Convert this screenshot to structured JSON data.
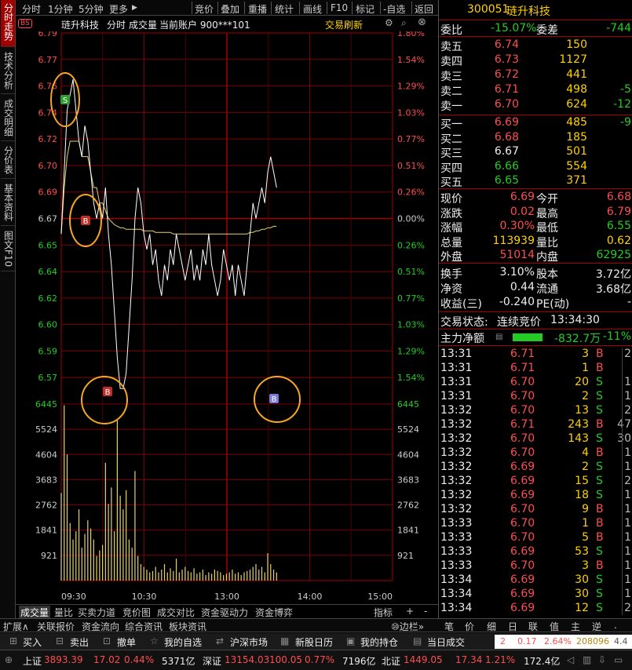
{
  "left_tabs": [
    "分时走势",
    "技术分析",
    "成交明细",
    "分价表",
    "基本资料",
    "图文F10"
  ],
  "top_menu": {
    "left": [
      "分时",
      "1分钟",
      "5分钟",
      "更多"
    ],
    "right": [
      "竞价",
      "叠加",
      "重播",
      "统计",
      "画线",
      "F10",
      "标记",
      "-自选",
      "返回"
    ]
  },
  "chart_info": {
    "name": "琏升科技",
    "mode": "分时",
    "volume_label": "成交量",
    "account": "当前账户 900***101",
    "refresh": "交易刷新",
    "bs_badge": "BS"
  },
  "price_axis": {
    "left": [
      "6.79",
      "6.77",
      "6.76",
      "6.74",
      "6.72",
      "6.70",
      "6.69",
      "6.67",
      "6.65",
      "6.64",
      "6.62",
      "6.60",
      "6.59",
      "6.57",
      "6445"
    ],
    "right": [
      "1.80%",
      "1.54%",
      "1.29%",
      "1.03%",
      "0.77%",
      "0.51%",
      "0.26%",
      "0.00%",
      "0.26%",
      "0.51%",
      "0.77%",
      "1.03%",
      "1.29%",
      "1.54%",
      "6445"
    ]
  },
  "volume_axis": [
    "5524",
    "4604",
    "3683",
    "2762",
    "1841",
    "921"
  ],
  "time_axis": [
    "09:30",
    "10:30",
    "13:00",
    "14:00",
    "15:00"
  ],
  "chart_data": {
    "type": "line",
    "prev_close": 6.67,
    "ylim": [
      6.55,
      6.79
    ],
    "price": [
      6.66,
      6.7,
      6.74,
      6.75,
      6.76,
      6.74,
      6.72,
      6.71,
      6.73,
      6.72,
      6.7,
      6.68,
      6.67,
      6.68,
      6.67,
      6.69,
      6.66,
      6.64,
      6.61,
      6.58,
      6.56,
      6.56,
      6.57,
      6.6,
      6.63,
      6.67,
      6.69,
      6.68,
      6.66,
      6.65,
      6.66,
      6.64,
      6.65,
      6.63,
      6.62,
      6.64,
      6.63,
      6.65,
      6.64,
      6.66,
      6.65,
      6.64,
      6.63,
      6.64,
      6.65,
      6.63,
      6.64,
      6.63,
      6.65,
      6.64,
      6.66,
      6.64,
      6.63,
      6.62,
      6.63,
      6.65,
      6.64,
      6.63,
      6.64,
      6.62,
      6.64,
      6.63,
      6.62,
      6.64,
      6.66,
      6.68,
      6.67,
      6.68,
      6.69,
      6.68,
      6.7,
      6.71,
      6.7,
      6.69
    ],
    "avg": [
      6.66,
      6.69,
      6.71,
      6.72,
      6.72,
      6.72,
      6.72,
      6.71,
      6.71,
      6.71,
      6.7,
      6.69,
      6.69,
      6.68,
      6.68,
      6.675,
      6.67,
      6.668,
      6.666,
      6.665,
      6.664,
      6.664,
      6.663,
      6.663,
      6.663,
      6.663,
      6.663,
      6.663,
      6.662,
      6.662,
      6.662,
      6.662,
      6.661,
      6.661,
      6.661,
      6.661,
      6.661,
      6.661,
      6.66,
      6.66,
      6.66,
      6.66,
      6.66,
      6.66,
      6.66,
      6.66,
      6.66,
      6.66,
      6.66,
      6.66,
      6.66,
      6.66,
      6.66,
      6.66,
      6.66,
      6.66,
      6.66,
      6.66,
      6.66,
      6.66,
      6.66,
      6.66,
      6.66,
      6.66,
      6.661,
      6.661,
      6.662,
      6.662,
      6.663,
      6.663,
      6.664,
      6.664,
      6.665,
      6.665
    ],
    "volume": [
      3200,
      6400,
      4600,
      2100,
      1500,
      1800,
      2600,
      1200,
      1700,
      2200,
      1900,
      1500,
      900,
      1100,
      1300,
      4300,
      2800,
      3400,
      1800,
      5900,
      3100,
      2600,
      3300,
      1500,
      1200,
      4000,
      900,
      600,
      500,
      400,
      300,
      350,
      500,
      300,
      400,
      600,
      300,
      450,
      350,
      800,
      300,
      400,
      500,
      350,
      300,
      450,
      250,
      300,
      400,
      200,
      300,
      250,
      400,
      350,
      300,
      200,
      250,
      300,
      400,
      250,
      300,
      200,
      300,
      350,
      400,
      500,
      600,
      400,
      500,
      300,
      1000,
      600,
      400,
      300
    ],
    "markers": [
      {
        "type": "S",
        "price": 6.735
      },
      {
        "type": "B",
        "price": 6.668
      },
      {
        "type": "B",
        "price": 6.57
      },
      {
        "type": "B",
        "price": 6.56
      }
    ],
    "volume_max": 6445
  },
  "bottom_tabs": [
    "成交量",
    "量比",
    "买卖力道",
    "竞价图",
    "成交对比",
    "资金驱动力",
    "资金博弈",
    "指标",
    "+",
    "-"
  ],
  "stock": {
    "code": "300051",
    "name": "琏升科技"
  },
  "weibi": {
    "label1": "委比",
    "v1": "-15.07%",
    "label2": "委差",
    "v2": "-744"
  },
  "asks": [
    {
      "label": "卖五",
      "price": "6.74",
      "vol": "150",
      "chg": ""
    },
    {
      "label": "卖四",
      "price": "6.73",
      "vol": "1127",
      "chg": ""
    },
    {
      "label": "卖三",
      "price": "6.72",
      "vol": "441",
      "chg": ""
    },
    {
      "label": "卖二",
      "price": "6.71",
      "vol": "498",
      "chg": "-5"
    },
    {
      "label": "卖一",
      "price": "6.70",
      "vol": "624",
      "chg": "-12"
    }
  ],
  "bids": [
    {
      "label": "买一",
      "price": "6.69",
      "vol": "485",
      "chg": "-9"
    },
    {
      "label": "买二",
      "price": "6.68",
      "vol": "185",
      "chg": ""
    },
    {
      "label": "买三",
      "price": "6.67",
      "vol": "501",
      "chg": ""
    },
    {
      "label": "买四",
      "price": "6.66",
      "vol": "554",
      "chg": ""
    },
    {
      "label": "买五",
      "price": "6.65",
      "vol": "371",
      "chg": ""
    }
  ],
  "quote": [
    [
      {
        "l": "现价",
        "v": "6.69",
        "c": "red"
      },
      {
        "l": "今开",
        "v": "6.68",
        "c": "red"
      }
    ],
    [
      {
        "l": "涨跌",
        "v": "0.02",
        "c": "red"
      },
      {
        "l": "最高",
        "v": "6.79",
        "c": "red"
      }
    ],
    [
      {
        "l": "涨幅",
        "v": "0.30%",
        "c": "red"
      },
      {
        "l": "最低",
        "v": "6.55",
        "c": "green"
      }
    ],
    [
      {
        "l": "总量",
        "v": "113939",
        "c": "yellow"
      },
      {
        "l": "量比",
        "v": "0.62",
        "c": "yellow"
      }
    ],
    [
      {
        "l": "外盘",
        "v": "51014",
        "c": "red"
      },
      {
        "l": "内盘",
        "v": "62925",
        "c": "green"
      }
    ]
  ],
  "quote2": [
    [
      {
        "l": "换手",
        "v": "3.10%"
      },
      {
        "l": "股本",
        "v": "3.72亿"
      }
    ],
    [
      {
        "l": "净资",
        "v": "0.44"
      },
      {
        "l": "流通",
        "v": "3.68亿"
      }
    ],
    [
      {
        "l": "收益(三)",
        "v": "-0.240"
      },
      {
        "l": "PE(动)",
        "v": "-"
      }
    ]
  ],
  "status": {
    "label": "交易状态:",
    "value": "连续竞价",
    "time": "13:34:30"
  },
  "mainflow": {
    "label": "主力净额",
    "value": "-832.7万",
    "pct": "-11%"
  },
  "ticks": [
    [
      "13:31",
      "6.71",
      "3",
      "B",
      "2"
    ],
    [
      "13:31",
      "6.71",
      "1",
      "B",
      ""
    ],
    [
      "13:31",
      "6.70",
      "20",
      "S",
      "1"
    ],
    [
      "13:31",
      "6.70",
      "2",
      "S",
      "1"
    ],
    [
      "13:32",
      "6.70",
      "13",
      "S",
      "2"
    ],
    [
      "13:32",
      "6.71",
      "243",
      "B",
      "47"
    ],
    [
      "13:32",
      "6.70",
      "143",
      "S",
      "30"
    ],
    [
      "13:32",
      "6.70",
      "4",
      "B",
      "1"
    ],
    [
      "13:32",
      "6.69",
      "2",
      "S",
      "1"
    ],
    [
      "13:32",
      "6.69",
      "15",
      "S",
      "2"
    ],
    [
      "13:32",
      "6.69",
      "18",
      "S",
      "1"
    ],
    [
      "13:32",
      "6.70",
      "9",
      "B",
      "1"
    ],
    [
      "13:33",
      "6.70",
      "1",
      "B",
      "1"
    ],
    [
      "13:33",
      "6.70",
      "5",
      "B",
      "1"
    ],
    [
      "13:33",
      "6.69",
      "53",
      "S",
      "1"
    ],
    [
      "13:33",
      "6.70",
      "3",
      "B",
      "1"
    ],
    [
      "13:34",
      "6.69",
      "30",
      "S",
      "1"
    ],
    [
      "13:34",
      "6.69",
      "30",
      "S",
      "1"
    ],
    [
      "13:34",
      "6.69",
      "12",
      "S",
      "2"
    ]
  ],
  "toolrow_left": [
    "扩展∧",
    "关联报价",
    "资金流向",
    "综合资讯",
    "板块资讯"
  ],
  "toolrow_right": [
    "▶",
    "⑩边栏»",
    "笔",
    "价",
    "细",
    "日",
    "联",
    "值",
    "主",
    "逆",
    "."
  ],
  "trade_buttons": [
    "买入",
    "卖出",
    "撤单",
    "我的自选",
    "沪深市场",
    "新股日历",
    "我的持仓",
    "当日成交"
  ],
  "trade_quote": {
    "a": "2",
    "b": "0.17",
    "c": "2.64%",
    "d": "208096",
    "e": "4.4"
  },
  "indices": [
    {
      "name": "上证",
      "val": "3893.39",
      "chg": "17.02",
      "pct": "0.44%",
      "amt": "5371亿"
    },
    {
      "name": "深证",
      "val": "13154.03",
      "chg": "100.05",
      "pct": "0.77%",
      "amt": "7196亿"
    },
    {
      "name": "北证",
      "val": "1449.05",
      "chg": "17.34",
      "pct": "1.21%",
      "amt": "172.4亿"
    }
  ]
}
